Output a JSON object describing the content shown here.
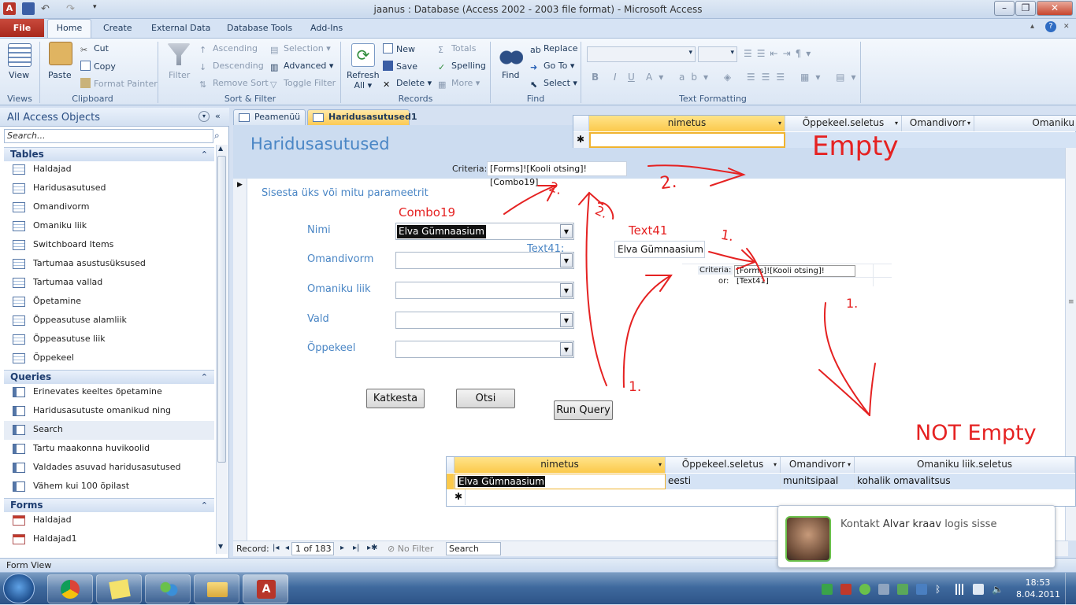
{
  "window": {
    "title": "jaanus : Database (Access 2002 - 2003 file format)  -  Microsoft Access"
  },
  "ribbon": {
    "tabs": {
      "file": "File",
      "home": "Home",
      "create": "Create",
      "external": "External Data",
      "dbtools": "Database Tools",
      "addins": "Add-Ins"
    },
    "views": {
      "view": "View",
      "group": "Views"
    },
    "clipboard": {
      "paste": "Paste",
      "cut": "Cut",
      "copy": "Copy",
      "format_painter": "Format Painter",
      "group": "Clipboard"
    },
    "sortfilter": {
      "filter": "Filter",
      "ascending": "Ascending",
      "descending": "Descending",
      "remove_sort": "Remove Sort",
      "selection": "Selection",
      "advanced": "Advanced",
      "toggle_filter": "Toggle Filter",
      "group": "Sort & Filter"
    },
    "records": {
      "refresh": "Refresh",
      "refresh2": "All",
      "new": "New",
      "save": "Save",
      "delete": "Delete",
      "totals": "Totals",
      "spelling": "Spelling",
      "more": "More",
      "group": "Records"
    },
    "find": {
      "find": "Find",
      "replace": "Replace",
      "goto": "Go To",
      "select": "Select",
      "group": "Find"
    },
    "text": {
      "bold": "B",
      "italic": "I",
      "underline": "U",
      "group": "Text Formatting"
    }
  },
  "nav": {
    "header": "All Access Objects",
    "search_placeholder": "Search...",
    "tables_label": "Tables",
    "tables": [
      "Haldajad",
      "Haridusasutused",
      "Omandivorm",
      "Omaniku liik",
      "Switchboard Items",
      "Tartumaa asustusüksused",
      "Tartumaa vallad",
      "Õpetamine",
      "Õppeasutuse alamliik",
      "Õppeasutuse liik",
      "Õppekeel"
    ],
    "queries_label": "Queries",
    "queries": [
      "Erinevates keeltes õpetamine",
      "Haridusasutuste omanikud ning omandiv...",
      "Search",
      "Tartu maakonna huvikoolid",
      "Valdades asuvad haridusasutused",
      "Vähem kui 100 õpilast"
    ],
    "forms_label": "Forms",
    "forms": [
      "Haldajad",
      "Haldajad1"
    ]
  },
  "doc_tabs": [
    "Peamenüü",
    "Haridusasutused1"
  ],
  "form": {
    "title": "Haridusasutused",
    "criteria_label": "Criteria:",
    "criteria_value": "[Forms]![Kooli otsing]![Combo19]",
    "intro": "Sisesta üks või mitu parameetrit",
    "fields": {
      "nimi": {
        "label": "Nimi",
        "value": "Elva Gümnaasium"
      },
      "omandivorm": {
        "label": "Omandivorm"
      },
      "omaniku_liik": {
        "label": "Omaniku liik"
      },
      "vald": {
        "label": "Vald"
      },
      "oppekeel": {
        "label": "Õppekeel"
      }
    },
    "text41_label": "Text41:",
    "text41_value": "Elva Gümnaasium",
    "criteria2_label": "Criteria:",
    "or_label": "or:",
    "criteria2_value": "[Forms]![Kooli otsing]![Text41]",
    "buttons": {
      "cancel": "Katkesta",
      "search": "Otsi",
      "run": "Run Query"
    }
  },
  "top_grid": {
    "columns": [
      "nimetus",
      "Õppekeel.seletus",
      "Omandivorr",
      "Omaniku"
    ],
    "new_row_marker": "✱"
  },
  "bottom_grid": {
    "columns": [
      "nimetus",
      "Õppekeel.seletus",
      "Omandivorr",
      "Omaniku liik.seletus"
    ],
    "row": [
      "Elva Gümnaasium",
      "eesti",
      "munitsipaal",
      "kohalik omavalitsus"
    ],
    "new_row_marker": "✱"
  },
  "annotations": {
    "empty": "Empty",
    "not_empty": "NOT Empty",
    "combo19": "Combo19",
    "text41": "Text41",
    "two": "2.",
    "one": "1."
  },
  "record_nav": {
    "label": "Record:",
    "position": "1 of 183",
    "no_filter": "No Filter",
    "search": "Search"
  },
  "status_bar": {
    "text": "Form View"
  },
  "toast": {
    "prefix": "Kontakt",
    "name": "Alvar kraav",
    "suffix": "logis sisse"
  },
  "clock": {
    "time": "18:53",
    "date": "8.04.2011"
  },
  "colors": {
    "accent_red": "#e52222",
    "file_tab": "#b7352a",
    "header_active": "#fbc94b"
  }
}
